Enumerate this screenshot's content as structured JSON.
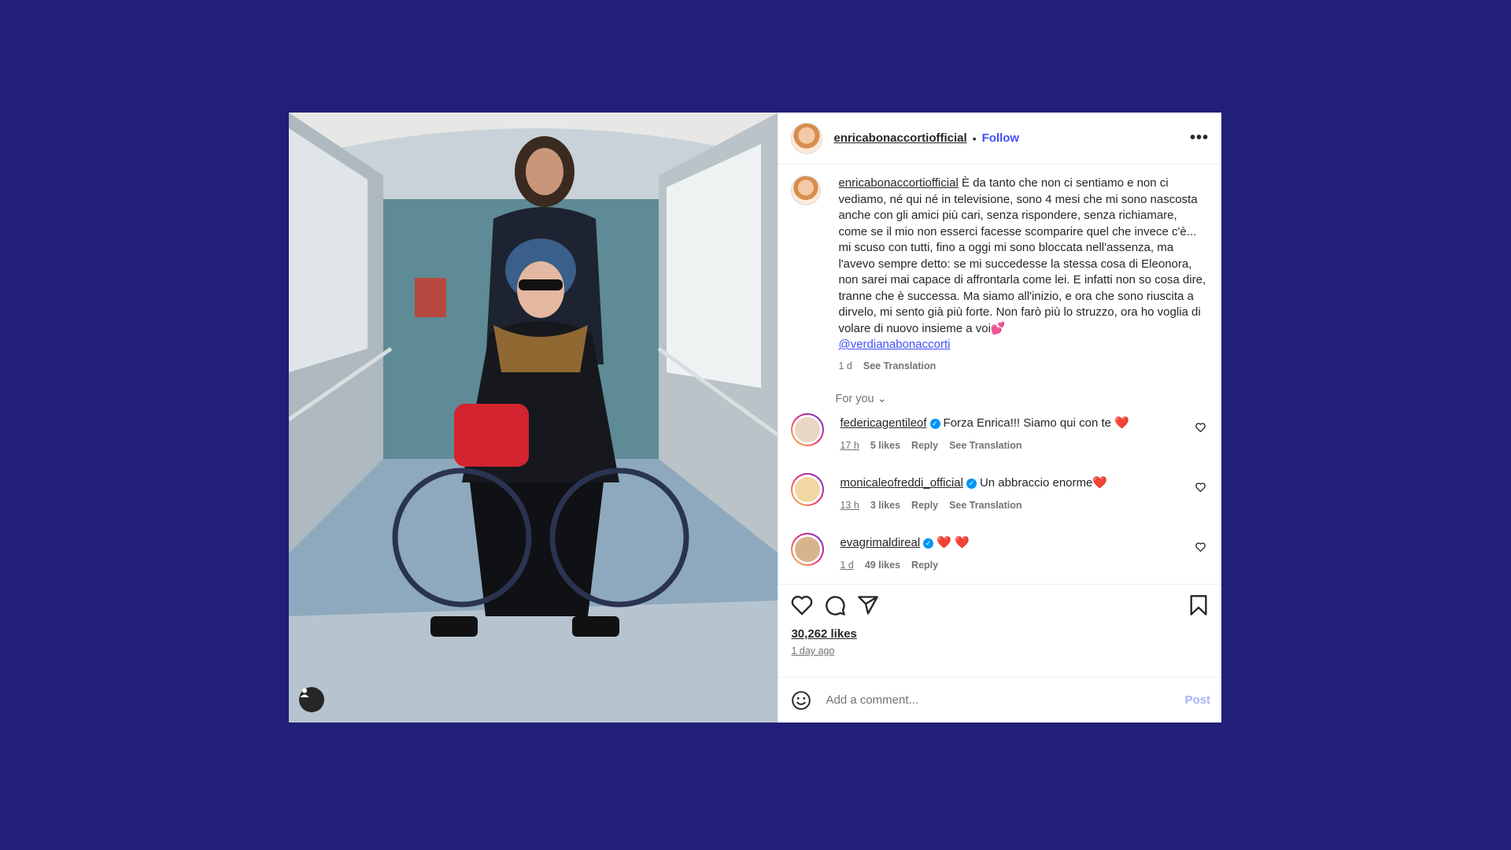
{
  "post": {
    "username": "enricabonaccortiofficial",
    "follow_label": "Follow",
    "more_label": "•••"
  },
  "caption": {
    "username": "enricabonaccortiofficial",
    "text": "È da tanto che non ci sentiamo e non ci vediamo, né qui né in televisione, sono 4 mesi che mi sono nascosta anche con gli amici più cari, senza rispondere, senza richiamare, come se il mio non esserci facesse scomparire quel che invece c'è... mi scuso con tutti, fino a oggi mi sono bloccata nell'assenza, ma l'avevo sempre detto: se mi succedesse la stessa cosa di Eleonora, non sarei mai capace di affrontarla come lei. E infatti non so cosa dire, tranne che è successa. Ma siamo all'inizio, e ora che sono riuscita a dirvelo, mi sento già più forte. Non farò più lo struzzo, ora ho voglia di volare di nuovo insieme a voi💕",
    "mention": "@verdianabonaccorti",
    "time": "1 d",
    "see_translation": "See Translation"
  },
  "for_you_label": "For you",
  "comments": [
    {
      "username": "federicagentileof",
      "text": "Forza Enrica!!! Siamo qui con te ",
      "emoji": "❤️",
      "time": "17 h",
      "likes": "5 likes",
      "reply": "Reply",
      "see_translation": "See Translation",
      "avatar_color": "#e9d6c4"
    },
    {
      "username": "monicaleofreddi_official",
      "text": "Un abbraccio enorme",
      "emoji": "❤️",
      "time": "13 h",
      "likes": "3 likes",
      "reply": "Reply",
      "see_translation": "See Translation",
      "avatar_color": "#f2d7a2"
    },
    {
      "username": "evagrimaldireal",
      "text": "",
      "emoji": "❤️ ❤️",
      "time": "1 d",
      "likes": "49 likes",
      "reply": "Reply",
      "avatar_color": "#d6b58d"
    }
  ],
  "likes_count": "30,262 likes",
  "time_ago": "1 day ago",
  "comment_input": {
    "placeholder": "Add a comment...",
    "post_label": "Post"
  },
  "icons": {
    "like": "heart-icon",
    "comment": "comment-icon",
    "share": "share-icon",
    "save": "bookmark-icon",
    "emoji": "emoji-icon",
    "tagged": "user-tag-icon"
  },
  "colors": {
    "background": "#211f77",
    "link": "#4150f7",
    "heart": "#e91e63",
    "verified": "#0095f6"
  }
}
